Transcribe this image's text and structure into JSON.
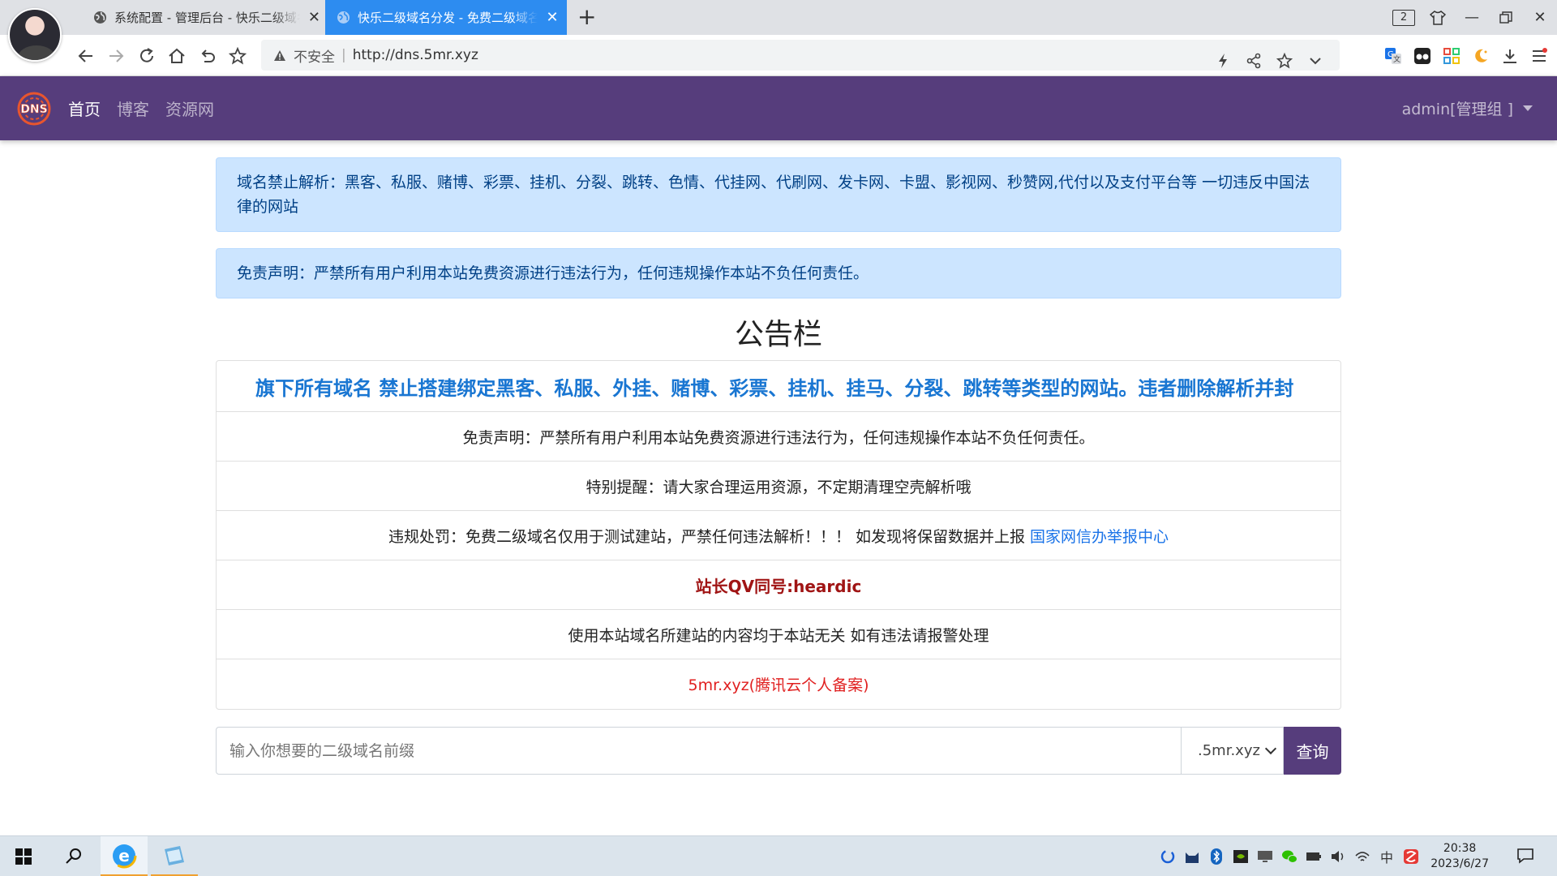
{
  "browser": {
    "tabs": [
      {
        "title": "系统配置 - 管理后台 - 快乐二级域名分发",
        "active": false
      },
      {
        "title": "快乐二级域名分发 - 免费二级域名",
        "active": true
      }
    ],
    "tab_count": "2",
    "address": {
      "security_label": "不安全",
      "separator": "|",
      "url": "http://dns.5mr.xyz"
    }
  },
  "navbar": {
    "brand_icon": "dns-logo-icon",
    "links": [
      {
        "label": "首页",
        "active": true
      },
      {
        "label": "博客",
        "active": false
      },
      {
        "label": "资源网",
        "active": false
      }
    ],
    "user": "admin[管理组 ]"
  },
  "alerts": {
    "ban_notice": "域名禁止解析：黑客、私服、赌博、彩票、挂机、分裂、跳转、色情、代挂网、代刷网、发卡网、卡盟、影视网、秒赞网,代付以及支付平台等 一切违反中国法律的网站",
    "disclaimer": "免责声明：严禁所有用户利用本站免费资源进行违法行为，任何违规操作本站不负任何责任。"
  },
  "board": {
    "title": "公告栏",
    "marquee": "旗下所有域名 禁止搭建绑定黑客、私服、外挂、赌博、彩票、挂机、挂马、分裂、跳转等类型的网站。违者删除解析并封",
    "items": {
      "disclaimer": "免责声明：严禁所有用户利用本站免费资源进行违法行为，任何违规操作本站不负任何责任。",
      "reminder": "特别提醒：请大家合理运用资源，不定期清理空壳解析哦",
      "penalty_text": "违规处罚：免费二级域名仅用于测试建站，严禁任何违法解析！！！ 如发现将保留数据并上报",
      "penalty_link": "国家网信办举报中心",
      "contact": "站长QV同号:heardic",
      "liability": "使用本站域名所建站的内容均于本站无关 如有违法请报警处理",
      "beian": "5mr.xyz(腾讯云个人备案)"
    }
  },
  "query": {
    "placeholder": "输入你想要的二级域名前缀",
    "suffix": ".5mr.xyz",
    "button": "查询"
  },
  "taskbar": {
    "time": "20:38",
    "date": "2023/6/27",
    "input_method": "中"
  },
  "colors": {
    "navbar": "#563d7c",
    "active_tab": "#2d8cf0",
    "alert_bg": "#cce5ff",
    "marquee_text": "#1976d2",
    "contact_text": "#a01414",
    "beian_text": "#e01f1f"
  }
}
